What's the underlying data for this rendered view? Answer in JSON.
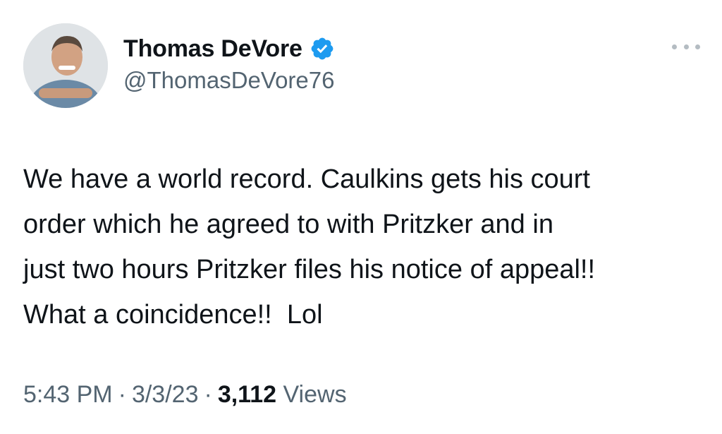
{
  "author": {
    "display_name": "Thomas DeVore",
    "handle": "@ThomasDeVore76",
    "verified": true,
    "verified_badge_icon": "verified-badge-icon",
    "verified_color": "#1d9bf0",
    "avatar_icon": "avatar-photo"
  },
  "tweet": {
    "text": "We have a world record. Caulkins gets his court\norder which he agreed to with Pritzker and in\njust two hours Pritzker files his notice of appeal!!\nWhat a coincidence!!  Lol"
  },
  "meta": {
    "time": "5:43 PM",
    "separator": "·",
    "date": "3/3/23",
    "views_count": "3,112",
    "views_label": "Views"
  },
  "more_menu_icon": "more-options-icon",
  "colors": {
    "text_primary": "#0f1419",
    "text_secondary": "#536471"
  }
}
